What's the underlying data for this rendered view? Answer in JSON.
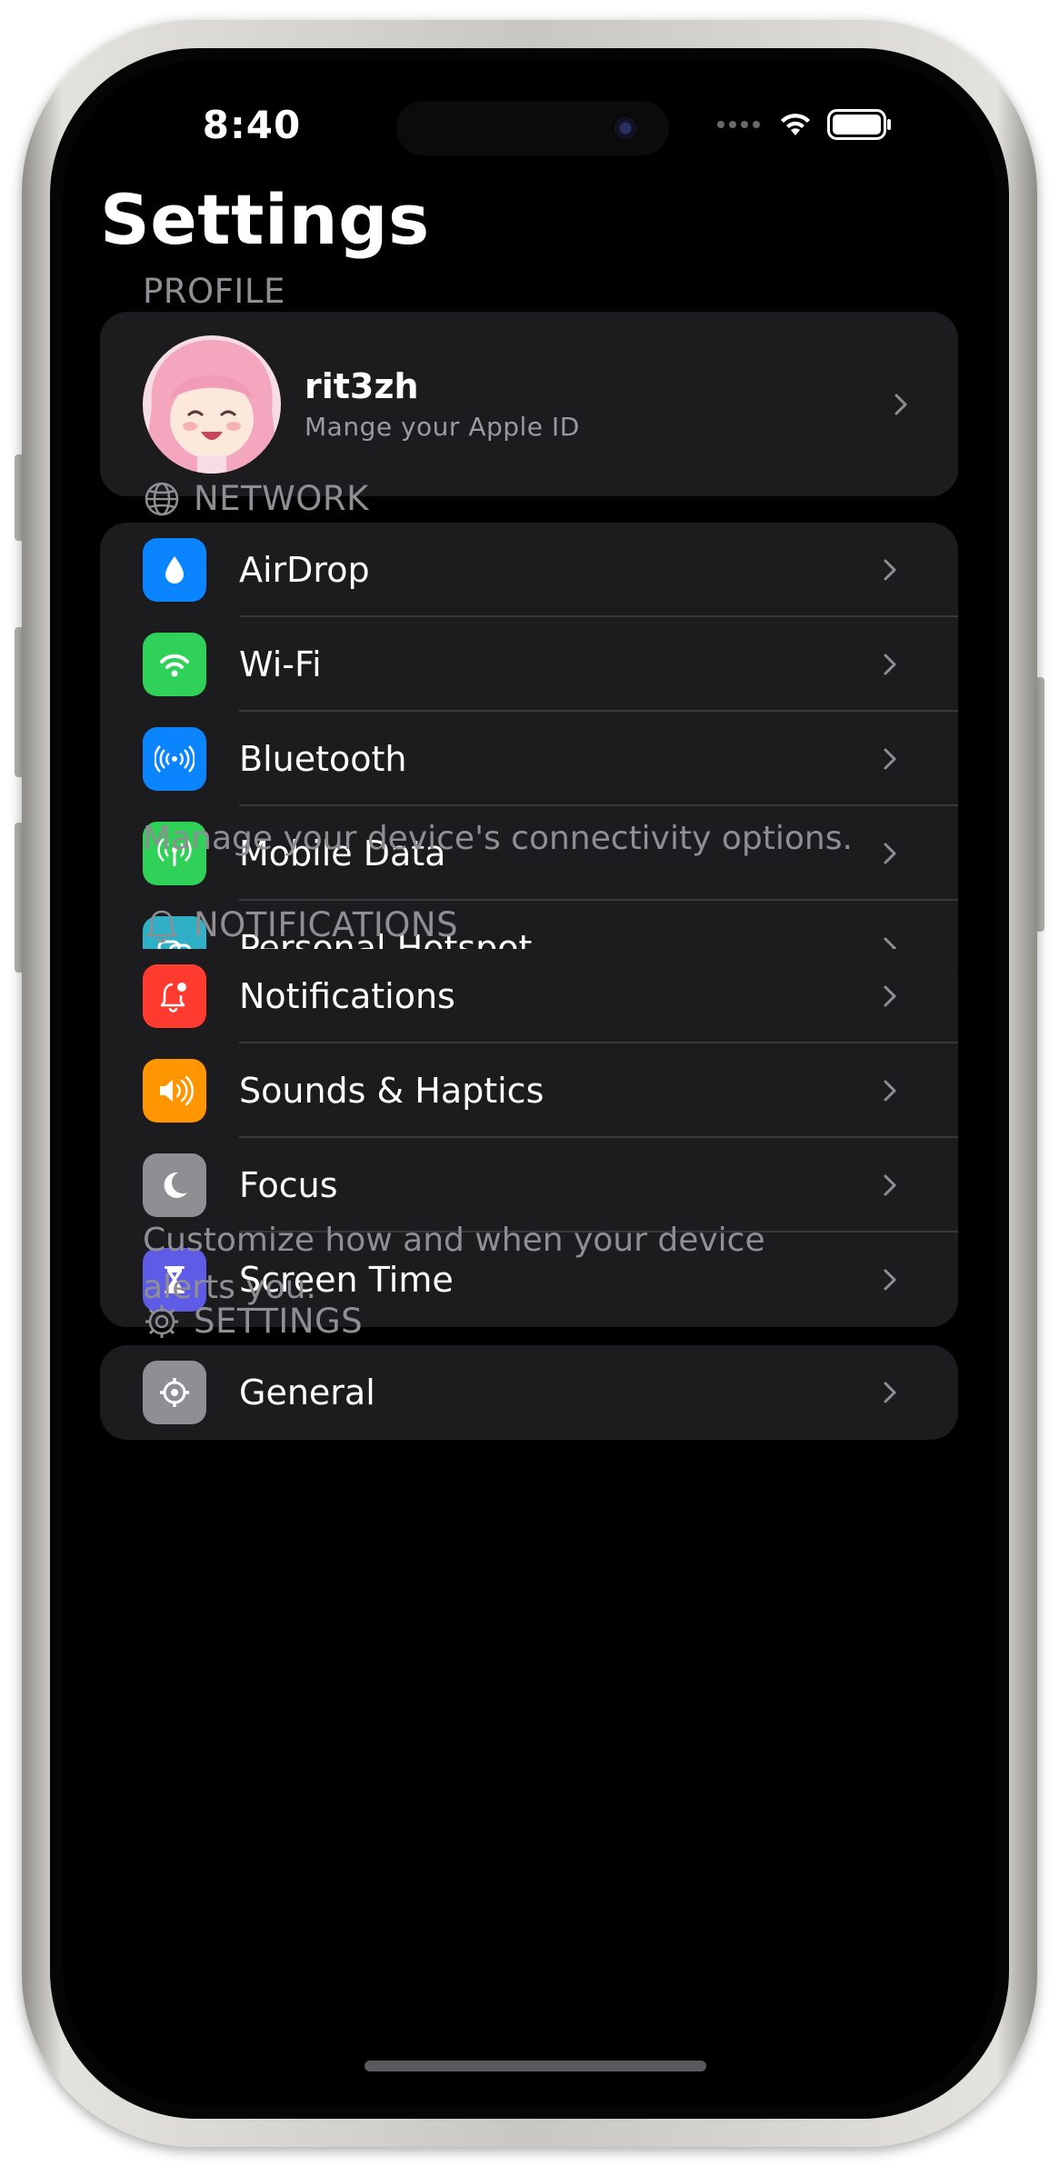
{
  "status_bar": {
    "time": "8:40"
  },
  "page": {
    "title": "Settings"
  },
  "profile": {
    "header": "PROFILE",
    "name": "rit3zh",
    "subtitle": "Mange your Apple ID"
  },
  "network": {
    "header": "NETWORK",
    "footer": "Manage your device's connectivity options.",
    "items": [
      {
        "label": "AirDrop",
        "icon": "airdrop-icon",
        "color": "#0a84ff"
      },
      {
        "label": "Wi-Fi",
        "icon": "wifi-icon",
        "color": "#30d158"
      },
      {
        "label": "Bluetooth",
        "icon": "bluetooth-icon",
        "color": "#0a84ff"
      },
      {
        "label": "Mobile Data",
        "icon": "antenna-icon",
        "color": "#30d158"
      },
      {
        "label": "Personal Hotspot",
        "icon": "link-icon",
        "color": "#30b0c7"
      }
    ]
  },
  "notifications": {
    "header": "NOTIFICATIONS",
    "footer": "Customize how and when your device alerts you.",
    "items": [
      {
        "label": "Notifications",
        "icon": "bell-badge-icon",
        "color": "#ff3b30"
      },
      {
        "label": "Sounds & Haptics",
        "icon": "speaker-icon",
        "color": "#ff9500"
      },
      {
        "label": "Focus",
        "icon": "moon-icon",
        "color": "#8e8e93"
      },
      {
        "label": "Screen Time",
        "icon": "hourglass-icon",
        "color": "#5e5ce6"
      }
    ]
  },
  "settings": {
    "header": "SETTINGS",
    "items": [
      {
        "label": "General",
        "icon": "gear-icon",
        "color": "#8e8e93"
      }
    ]
  }
}
